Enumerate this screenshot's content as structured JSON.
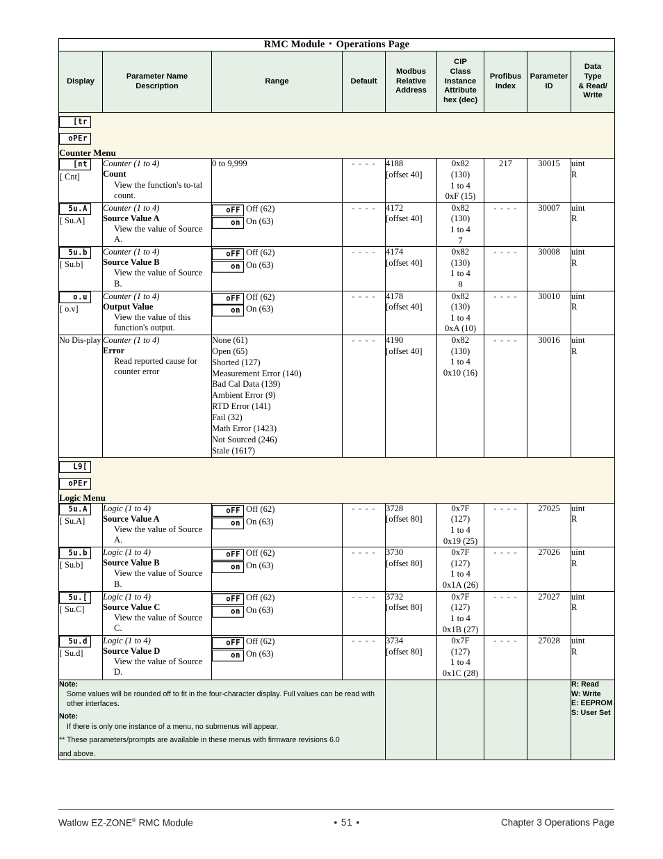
{
  "table": {
    "title_left": "RMC Module",
    "title_sep": "•",
    "title_right": "Operations Page",
    "headers": {
      "display": "Display",
      "parameter": "Parameter Name\nDescription",
      "range": "Range",
      "default": "Default",
      "modbus": "Modbus\nRelative\nAddress",
      "cip": "CIP\nClass\nInstance\nAttribute\nhex (dec)",
      "profibus": "Profibus\nIndex",
      "param_id": "Parameter\nID",
      "data_type": "Data\nType\n& Read/\nWrite"
    }
  },
  "sections": [
    {
      "id": "counter-menu",
      "badge_top": "[tr",
      "badge_bottom": "oPEr",
      "title": "Counter Menu",
      "rows": [
        {
          "id": "count",
          "display_seg": "[nt",
          "display_alt": "[ Cnt]",
          "context": "Counter (1 to 4)",
          "name": "Count",
          "desc": "View the function's to-tal count.",
          "range_text": "0 to 9,999",
          "range_options": [],
          "default": "- - - -",
          "modbus_addr": "4188",
          "modbus_offset": "[offset 40]",
          "cip": "0x82\n(130)\n1 to 4\n0xF (15)",
          "profibus": "217",
          "param_id": "30015",
          "data_type": "uint\nR"
        },
        {
          "id": "counter-source-value-a",
          "display_seg": "5u.A",
          "display_alt": "[ Su.A]",
          "context": "Counter (1 to 4)",
          "name": "Source Value A",
          "desc": "View the value of Source A.",
          "range_text": "",
          "range_options": [
            {
              "seg": "oFF",
              "label": "Off (62)"
            },
            {
              "seg": "on",
              "label": "On (63)"
            }
          ],
          "default": "- - - -",
          "modbus_addr": "4172",
          "modbus_offset": "[offset 40]",
          "cip": "0x82\n(130)\n1 to 4\n7",
          "profibus": "- - - -",
          "param_id": "30007",
          "data_type": "uint\nR"
        },
        {
          "id": "counter-source-value-b",
          "display_seg": "5u.b",
          "display_alt": "[ Su.b]",
          "context": "Counter (1 to 4)",
          "name": "Source Value B",
          "desc": "View the value of Source B.",
          "range_text": "",
          "range_options": [
            {
              "seg": "oFF",
              "label": "Off (62)"
            },
            {
              "seg": "on",
              "label": "On (63)"
            }
          ],
          "default": "- - - -",
          "modbus_addr": "4174",
          "modbus_offset": "[offset 40]",
          "cip": "0x82\n(130)\n1 to 4\n8",
          "profibus": "- - - -",
          "param_id": "30008",
          "data_type": "uint\nR"
        },
        {
          "id": "counter-output-value",
          "display_seg": "o.u",
          "display_alt": "[  o.v]",
          "context": "Counter (1 to 4)",
          "name": "Output Value",
          "desc": "View the value of this function's output.",
          "range_text": "",
          "range_options": [
            {
              "seg": "oFF",
              "label": "Off (62)"
            },
            {
              "seg": "on",
              "label": "On (63)"
            }
          ],
          "default": "- - - -",
          "modbus_addr": "4178",
          "modbus_offset": "[offset 40]",
          "cip": "0x82\n(130)\n1 to 4\n0xA (10)",
          "profibus": "- - - -",
          "param_id": "30010",
          "data_type": "uint\nR"
        },
        {
          "id": "counter-error",
          "display_seg": "",
          "display_nodisplay": "No Dis-play",
          "display_alt": "",
          "context": "Counter (1 to 4)",
          "name": "Error",
          "desc": "Read reported cause for counter error",
          "range_text": "None (61)\nOpen (65)\nShorted (127)\nMeasurement Error (140)\nBad Cal Data (139)\nAmbient Error (9)\nRTD Error (141)\nFail (32)\nMath Error (1423)\nNot Sourced (246)\nStale (1617)",
          "range_options": [],
          "default": "- - - -",
          "modbus_addr": "4190",
          "modbus_offset": "[offset 40]",
          "cip": "0x82\n(130)\n1 to 4\n0x10 (16)",
          "profibus": "- - - -",
          "param_id": "30016",
          "data_type": "uint\nR"
        }
      ]
    },
    {
      "id": "logic-menu",
      "badge_top": "L9[",
      "badge_bottom": "oPEr",
      "title": "Logic Menu",
      "rows": [
        {
          "id": "logic-source-value-a",
          "display_seg": "5u.A",
          "display_alt": "[ Su.A]",
          "context": "Logic (1 to 4)",
          "name": "Source Value A",
          "desc": "View the value of Source A.",
          "range_text": "",
          "range_options": [
            {
              "seg": "oFF",
              "label": "Off (62)"
            },
            {
              "seg": "on",
              "label": "On (63)"
            }
          ],
          "default": "- - - -",
          "modbus_addr": "3728",
          "modbus_offset": "[offset 80]",
          "cip": "0x7F\n(127)\n1 to 4\n0x19 (25)",
          "profibus": "- - - -",
          "param_id": "27025",
          "data_type": "uint\nR"
        },
        {
          "id": "logic-source-value-b",
          "display_seg": "5u.b",
          "display_alt": "[ Su.b]",
          "context": "Logic (1 to 4)",
          "name": "Source Value B",
          "desc": "View the value of Source B.",
          "range_text": "",
          "range_options": [
            {
              "seg": "oFF",
              "label": "Off (62)"
            },
            {
              "seg": "on",
              "label": "On (63)"
            }
          ],
          "default": "- - - -",
          "modbus_addr": "3730",
          "modbus_offset": "[offset 80]",
          "cip": "0x7F\n(127)\n1 to 4\n0x1A (26)",
          "profibus": "- - - -",
          "param_id": "27026",
          "data_type": "uint\nR"
        },
        {
          "id": "logic-source-value-c",
          "display_seg": "5u.[",
          "display_alt": "[ Su.C]",
          "context": "Logic (1 to 4)",
          "name": "Source Value C",
          "desc": "View the value of Source C.",
          "range_text": "",
          "range_options": [
            {
              "seg": "oFF",
              "label": "Off (62)"
            },
            {
              "seg": "on",
              "label": "On (63)"
            }
          ],
          "default": "- - - -",
          "modbus_addr": "3732",
          "modbus_offset": "[offset 80]",
          "cip": "0x7F\n(127)\n1 to 4\n0x1B (27)",
          "profibus": "- - - -",
          "param_id": "27027",
          "data_type": "uint\nR"
        },
        {
          "id": "logic-source-value-d",
          "display_seg": "5u.d",
          "display_alt": "[ Su.d]",
          "context": "Logic (1 to 4)",
          "name": "Source Value D",
          "desc": "View the value of Source D.",
          "range_text": "",
          "range_options": [
            {
              "seg": "oFF",
              "label": "Off (62)"
            },
            {
              "seg": "on",
              "label": "On (63)"
            }
          ],
          "default": "- - - -",
          "modbus_addr": "3734",
          "modbus_offset": "[offset 80]",
          "cip": "0x7F\n(127)\n1 to 4\n0x1C (28)",
          "profibus": "- - - -",
          "param_id": "27028",
          "data_type": "uint\nR"
        }
      ]
    }
  ],
  "notes": {
    "note1_label": "Note:",
    "note1_text": "Some values will be rounded off to fit in the four-character display. Full values can be read with other interfaces.",
    "note2_label": "Note:",
    "note2_text": "If there is only one instance of a menu, no submenus will appear.",
    "note3_text": "** These parameters/prompts are available in these menus with firmware revisions 6.0",
    "note3_cont": "and above.",
    "legend": "R: Read\nW: Write\nE: EEPROM\nS: User Set"
  },
  "footer": {
    "left_pre": "Watlow EZ-ZONE",
    "left_sup": "®",
    "left_post": " RMC Module",
    "page": "• 51 •",
    "right": "Chapter 3 Operations Page"
  }
}
